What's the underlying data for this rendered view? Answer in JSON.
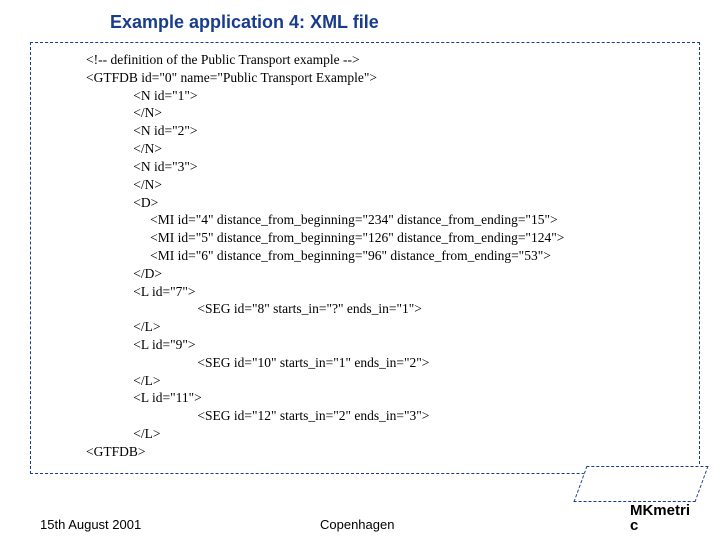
{
  "title": "Example application 4: XML file",
  "code": "<!-- definition of the Public Transport example -->\n<GTFDB id=\"0\" name=\"Public Transport Example\">\n              <N id=\"1\">\n              </N>\n              <N id=\"2\">\n              </N>\n              <N id=\"3\">\n              </N>\n              <D>\n                   <MI id=\"4\" distance_from_beginning=\"234\" distance_from_ending=\"15\">\n                   <MI id=\"5\" distance_from_beginning=\"126\" distance_from_ending=\"124\">\n                   <MI id=\"6\" distance_from_beginning=\"96\" distance_from_ending=\"53\">\n              </D>\n              <L id=\"7\">\n                                 <SEG id=\"8\" starts_in=\"?\" ends_in=\"1\">\n              </L>\n              <L id=\"9\">\n                                 <SEG id=\"10\" starts_in=\"1\" ends_in=\"2\">\n              </L>\n              <L id=\"11\">\n                                 <SEG id=\"12\" starts_in=\"2\" ends_in=\"3\">\n              </L>\n<GTFDB>",
  "footer": {
    "date": "15th August 2001",
    "place": "Copenhagen",
    "brand_line1": "MKmetri",
    "brand_line2": "c"
  }
}
